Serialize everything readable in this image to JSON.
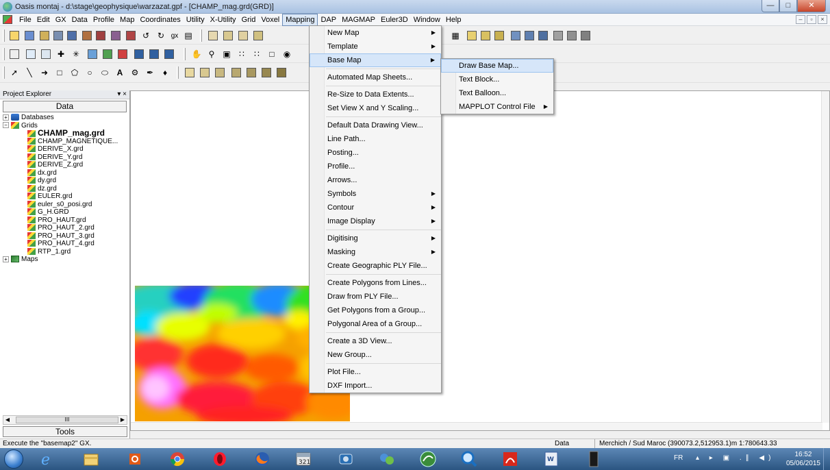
{
  "window": {
    "title": "Oasis montaj - d:\\stage\\geophysique\\warzazat.gpf - [CHAMP_mag.grd(GRD)]",
    "min": "—",
    "max": "□",
    "close": "✕"
  },
  "menubar": {
    "items": [
      "File",
      "Edit",
      "GX",
      "Data",
      "Profile",
      "Map",
      "Coordinates",
      "Utility",
      "X-Utility",
      "Grid",
      "Voxel",
      "Mapping",
      "DAP",
      "MAGMAP",
      "Euler3D",
      "Window",
      "Help"
    ],
    "active": "Mapping",
    "mdi_min": "–",
    "mdi_restore": "▫",
    "mdi_close": "×"
  },
  "explorer": {
    "header": "Project Explorer",
    "pin": "▾ ×",
    "tab": "Data",
    "tools_tab": "Tools",
    "databases": "Databases",
    "grids": "Grids",
    "maps": "Maps",
    "grid_files": [
      "CHAMP_mag.grd",
      "CHAMP_MAGNETIQUE...",
      "DERIVE_X.grd",
      "DERIVE_Y.grd",
      "DERIVE_Z.grd",
      "dx.grd",
      "dy.grd",
      "dz.grd",
      "EULER.grd",
      "euler_s0_posi.grd",
      "G_H.GRD",
      "PRO_HAUT.grd",
      "PRO_HAUT_2.grd",
      "PRO_HAUT_3.grd",
      "PRO_HAUT_4.grd",
      "RTP_1.grd"
    ],
    "scroll_thumb": "III"
  },
  "mapping_menu": {
    "items": [
      {
        "label": "New Map",
        "submenu": true
      },
      {
        "label": "Template",
        "submenu": true
      },
      {
        "label": "Base Map",
        "submenu": true,
        "highlighted": true
      },
      {
        "sep": true
      },
      {
        "label": "Automated Map Sheets..."
      },
      {
        "sep": true
      },
      {
        "label": "Re-Size to Data Extents..."
      },
      {
        "label": "Set View X and Y Scaling..."
      },
      {
        "sep": true
      },
      {
        "label": "Default Data Drawing View..."
      },
      {
        "label": "Line Path..."
      },
      {
        "label": "Posting..."
      },
      {
        "label": "Profile..."
      },
      {
        "label": "Arrows..."
      },
      {
        "label": "Symbols",
        "submenu": true
      },
      {
        "label": "Contour",
        "submenu": true
      },
      {
        "label": "Image Display",
        "submenu": true
      },
      {
        "sep": true
      },
      {
        "label": "Digitising",
        "submenu": true
      },
      {
        "label": "Masking",
        "submenu": true
      },
      {
        "label": "Create Geographic PLY File..."
      },
      {
        "sep": true
      },
      {
        "label": "Create Polygons from Lines..."
      },
      {
        "label": "Draw from PLY File..."
      },
      {
        "label": "Get Polygons from a Group..."
      },
      {
        "label": "Polygonal Area of a Group..."
      },
      {
        "sep": true
      },
      {
        "label": "Create a 3D View..."
      },
      {
        "label": "New Group..."
      },
      {
        "sep": true
      },
      {
        "label": "Plot File..."
      },
      {
        "label": "DXF Import..."
      }
    ]
  },
  "basemap_submenu": {
    "items": [
      {
        "label": "Draw Base Map...",
        "highlighted": true
      },
      {
        "label": "Text Block..."
      },
      {
        "label": "Text Balloon..."
      },
      {
        "label": "MAPPLOT Control File",
        "submenu": true
      }
    ]
  },
  "statusbar": {
    "message": "Execute the \"basemap2\" GX.",
    "data": "Data",
    "projection": "Merchich / Sud Maroc  (390073.2,512953.1)m  1:780643.33"
  },
  "taskbar": {
    "lang": "FR",
    "tray_icons": "▴ ▸ ▣ .∥ ◀)",
    "time": "16:52",
    "date": "05/06/2015"
  },
  "colors": {
    "menu_highlight": "#d6e6f9",
    "taskbar": "#2b5581"
  }
}
